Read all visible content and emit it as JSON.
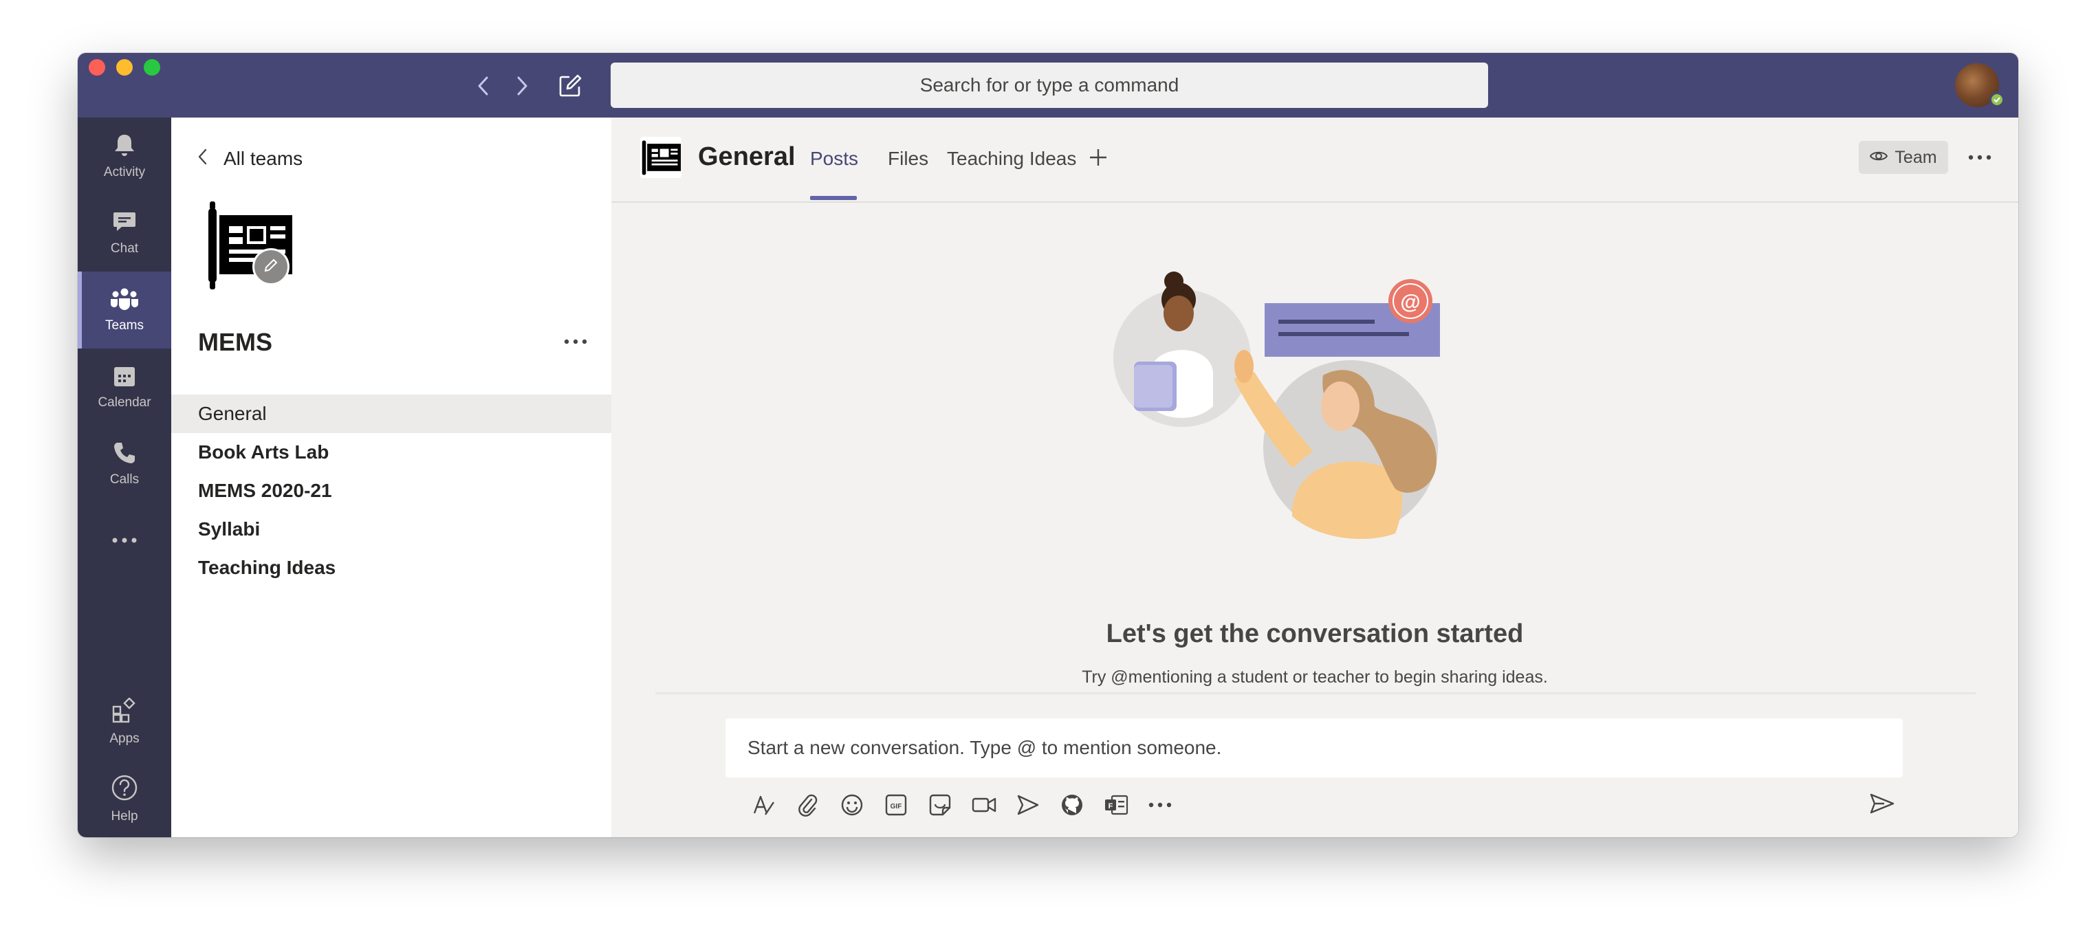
{
  "titlebar": {
    "search_placeholder": "Search for or type a command",
    "icons": [
      "back-chevron-icon",
      "forward-chevron-icon",
      "compose-icon"
    ],
    "color": "#464775"
  },
  "rail": {
    "items": [
      {
        "label": "Activity",
        "icon": "bell-icon"
      },
      {
        "label": "Chat",
        "icon": "chat-icon"
      },
      {
        "label": "Teams",
        "icon": "teams-icon",
        "active": true
      },
      {
        "label": "Calendar",
        "icon": "calendar-icon"
      },
      {
        "label": "Calls",
        "icon": "phone-icon"
      },
      {
        "label": "",
        "icon": "more-icon"
      },
      {
        "label": "Apps",
        "icon": "apps-icon"
      },
      {
        "label": "Help",
        "icon": "help-icon"
      }
    ],
    "color": "#33344a"
  },
  "panel": {
    "all_teams": "All teams",
    "team_name": "MEMS",
    "channels": [
      {
        "label": "General",
        "selected": true
      },
      {
        "label": "Book Arts Lab"
      },
      {
        "label": "MEMS 2020-21"
      },
      {
        "label": "Syllabi"
      },
      {
        "label": "Teaching Ideas"
      }
    ]
  },
  "main": {
    "channel_title": "General",
    "tabs": [
      {
        "label": "Posts",
        "active": true
      },
      {
        "label": "Files"
      },
      {
        "label": "Teaching Ideas"
      }
    ],
    "team_button": "Team",
    "empty_title": "Let's get the conversation started",
    "empty_subtitle": "Try @mentioning a student or teacher to begin sharing ideas.",
    "compose_placeholder": "Start a new conversation. Type @ to mention someone.",
    "toolbar_icons": [
      "format-icon",
      "attach-icon",
      "emoji-icon",
      "gif-icon",
      "sticker-icon",
      "meet-now-icon",
      "praise-icon",
      "github-icon",
      "forms-icon",
      "more-options-icon"
    ],
    "accent": "#6264a7"
  }
}
